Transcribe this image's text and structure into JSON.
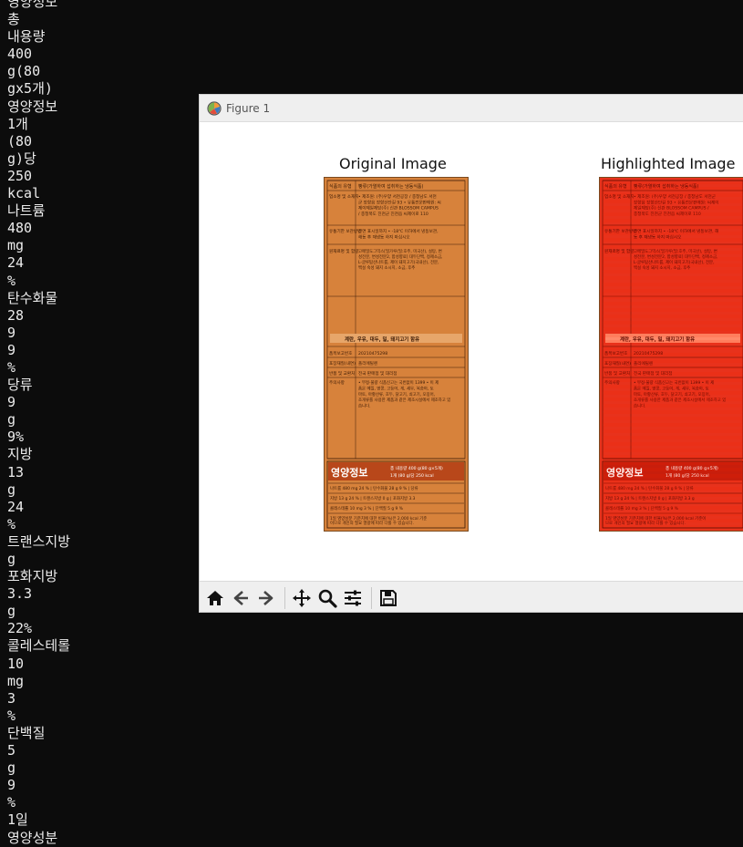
{
  "terminal": {
    "lines": [
      "영양정보",
      "총",
      "내용량",
      "400",
      "g(80",
      "gx5개)",
      "영양정보",
      "1개",
      "(80",
      "g)당",
      "250",
      "kcal",
      "나트륨",
      "480",
      "mg",
      "24",
      "%",
      "탄수화물",
      "28",
      "9",
      "9",
      "%",
      "당류",
      "9",
      "g",
      "9%",
      "지방",
      "13",
      "g",
      "24",
      "%",
      "트랜스지방",
      "g",
      "포화지방",
      "3.3",
      "g",
      "22%",
      "콜레스테롤",
      "10",
      "mg",
      "3",
      "%",
      "단백질",
      "5",
      "g",
      "9",
      "%",
      "1일",
      "영양성분"
    ]
  },
  "window": {
    "title": "Figure 1",
    "icon": "matplotlib-logo-icon"
  },
  "figure": {
    "left_title": "Original Image",
    "right_title": "Highlighted Image",
    "label": {
      "header_row": [
        "식품의 유형",
        "빵류(가열하여 섭취하는 냉동식품)"
      ],
      "maker_label": "업소명 및 소재지",
      "maker_text": "• 제조원: (주)우양 서천공장 / 충청남도 서천군 장항읍 장항산단길 93 • 유통전문판매원: 씨제이제일제당(주) 신관 BLOSSOM CAMPUS / 충청북도 진천군 진천읍 씨제이로 110",
      "storage_label": "유통기한 보관방법",
      "storage_text": "전면 표시일까지 • -18℃ 이하에서 냉동보관, 해동 후 재냉동 하지 마십시오",
      "ingredient_label": "원재료명 및 함량",
      "ingredient_text": "고메밀도그믹스[밀가루(밀:호주, 미국산), 설탕, 변성전분, 변성전분2, 합성향료] 대두단백, 정제소금, L-글루탐산나트륨, 제이 돼지고기(국내산), 전분, 백설 숙성 돼지 소시지, 소금, 후추",
      "allergy_text": "계란, 우유, 대두, 밀, 돼지고기 함유",
      "report_label": "품목보고번호",
      "report_no": "20210475298",
      "material_label": "포장재질(내면)",
      "material": "폴리에틸렌",
      "return_label": "반품 및 교환처",
      "return_place": "전국 판매점 및 대리점",
      "caution_label": "주의사항",
      "caution_text": "• 부정·불량 식품신고는 국번없이 1399 • 이 제품은 메밀, 땅콩, 고등어, 게, 새우, 복숭아, 토마토, 아황산류, 호두, 닭고기, 쇠고기, 오징어, 조개류를 사용한 제품과 같은 제조시설에서 제조하고 있습니다.",
      "nutrition_title": "영양정보",
      "nutrition_total": "총 내용량 400 g(80 g×5개)",
      "nutrition_serving": "1개 (80 g)당 250 kcal",
      "nutrition_rows": [
        "나트륨 480 mg 24 % | 탄수화물 28 g 9 % | 당류 9 g 9 %",
        "지방 13 g 24 % | 트랜스지방 0 g | 포화지방 3.3 g 22 %",
        "콜레스테롤 10 mg 3 % | 단백질 5 g 9 %",
        "1일 영양성분 기준치에 대한 비율(%)은 2,000 kcal 기준이므로 개인의 필요 열량에 따라 다를 수 있습니다."
      ]
    }
  },
  "toolbar": {
    "buttons": [
      "home-icon",
      "back-icon",
      "forward-icon",
      "pan-icon",
      "zoom-icon",
      "configure-subplots-icon",
      "save-icon"
    ]
  },
  "colors": {
    "terminal_bg": "#0c0c0c",
    "terminal_fg": "#ececec",
    "label_orange": "#d7823b",
    "highlight_red": "#e8321c",
    "nutrition_bar": "#b8471a"
  }
}
